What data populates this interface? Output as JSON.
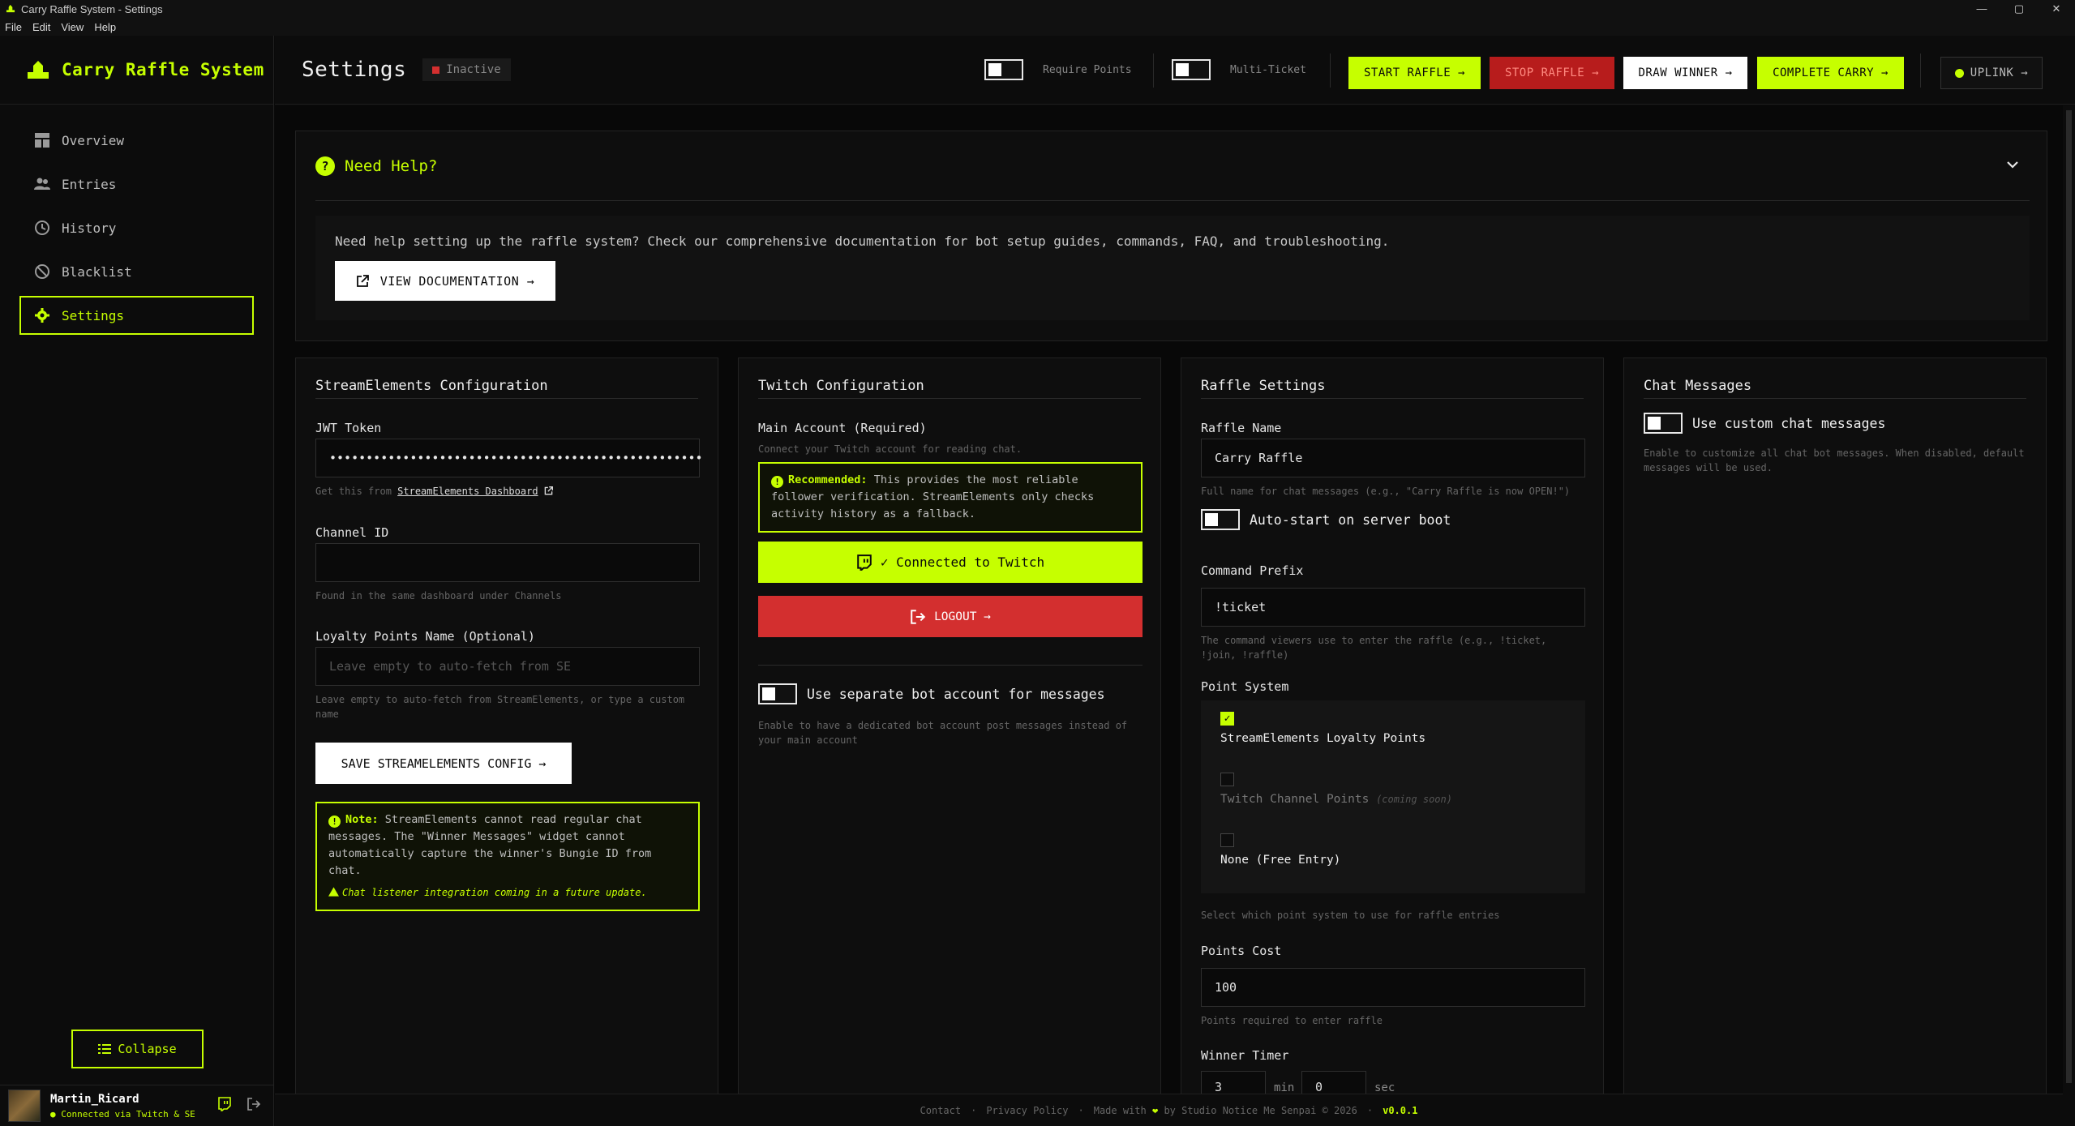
{
  "window": {
    "title": "Carry Raffle System - Settings",
    "controls": [
      "—",
      "▢",
      "✕"
    ]
  },
  "menu": [
    "File",
    "Edit",
    "View",
    "Help"
  ],
  "brand": {
    "name": "Carry Raffle System"
  },
  "nav": [
    {
      "label": "Overview",
      "icon": "grid-icon"
    },
    {
      "label": "Entries",
      "icon": "users-icon"
    },
    {
      "label": "History",
      "icon": "history-icon"
    },
    {
      "label": "Blacklist",
      "icon": "ban-icon"
    },
    {
      "label": "Settings",
      "icon": "gear-icon",
      "active": true
    }
  ],
  "collapse_label": "Collapse",
  "user": {
    "name": "Martin_Ricard",
    "status": "● Connected via Twitch & SE"
  },
  "header": {
    "title": "Settings",
    "status": "Inactive",
    "require_points": "Require Points",
    "multi_ticket": "Multi-Ticket",
    "start": "START RAFFLE  →",
    "stop": "STOP RAFFLE  →",
    "draw": "DRAW WINNER  →",
    "complete": "COMPLETE CARRY  →",
    "uplink": "UPLINK  →"
  },
  "help": {
    "title": "Need Help?",
    "text": "Need help setting up the raffle system? Check our comprehensive documentation for bot setup guides, commands, FAQ, and troubleshooting.",
    "button": "VIEW DOCUMENTATION  →"
  },
  "se": {
    "title": "StreamElements Configuration",
    "jwt_label": "JWT Token",
    "jwt_value": "•••••••••••••••••••••••••••••••••••••••••••••••••••",
    "jwt_hint_prefix": "Get this from",
    "jwt_hint_link": "StreamElements Dashboard",
    "channel_label": "Channel ID",
    "channel_value": "",
    "channel_hint": "Found in the same dashboard under Channels",
    "loyalty_label": "Loyalty Points Name (Optional)",
    "loyalty_placeholder": "Leave empty to auto-fetch from SE",
    "loyalty_hint": "Leave empty to auto-fetch from StreamElements, or type a custom name",
    "save_button": "SAVE STREAMELEMENTS CONFIG  →",
    "note_label": "Note:",
    "note_text": "StreamElements cannot read regular chat messages. The \"Winner Messages\" widget cannot automatically capture the winner's Bungie ID from chat.",
    "note_footer": "Chat listener integration coming in a future update."
  },
  "twitch": {
    "title": "Twitch Configuration",
    "main_label": "Main Account (Required)",
    "main_hint": "Connect your Twitch account for reading chat.",
    "rec_label": "Recommended:",
    "rec_text": "This provides the most reliable follower verification. StreamElements only checks activity history as a fallback.",
    "connected": "✓ Connected to Twitch",
    "logout": "LOGOUT  →",
    "bot_toggle": "Use separate bot account for messages",
    "bot_hint": "Enable to have a dedicated bot account post messages instead of your main account"
  },
  "raffle": {
    "title": "Raffle Settings",
    "name_label": "Raffle Name",
    "name_value": "Carry Raffle",
    "name_hint": "Full name for chat messages (e.g., \"Carry Raffle is now OPEN!\")",
    "autostart": "Auto-start on server boot",
    "prefix_label": "Command Prefix",
    "prefix_value": "!ticket",
    "prefix_hint": "The command viewers use to enter the raffle (e.g., !ticket, !join, !raffle)",
    "points_label": "Point System",
    "opt1": "StreamElements Loyalty Points",
    "opt2": "Twitch Channel Points",
    "opt2_note": "(coming soon)",
    "opt3": "None (Free Entry)",
    "points_hint": "Select which point system to use for raffle entries",
    "cost_label": "Points Cost",
    "cost_value": "100",
    "cost_hint": "Points required to enter raffle",
    "timer_label": "Winner Timer",
    "timer_min": "3",
    "timer_min_unit": "min",
    "timer_sec": "0",
    "timer_sec_unit": "sec"
  },
  "chat": {
    "title": "Chat Messages",
    "toggle": "Use custom chat messages",
    "hint": "Enable to customize all chat bot messages. When disabled, default messages will be used."
  },
  "footer": {
    "contact": "Contact",
    "privacy": "Privacy Policy",
    "made_with": "Made with",
    "heart": "❤",
    "by": "by Studio Notice Me Senpai © 2026",
    "sep": "·",
    "version": "v0.0.1"
  },
  "colors": {
    "accent": "#c6ff00",
    "danger": "#d32f2f",
    "background": "#0a0a0a"
  }
}
